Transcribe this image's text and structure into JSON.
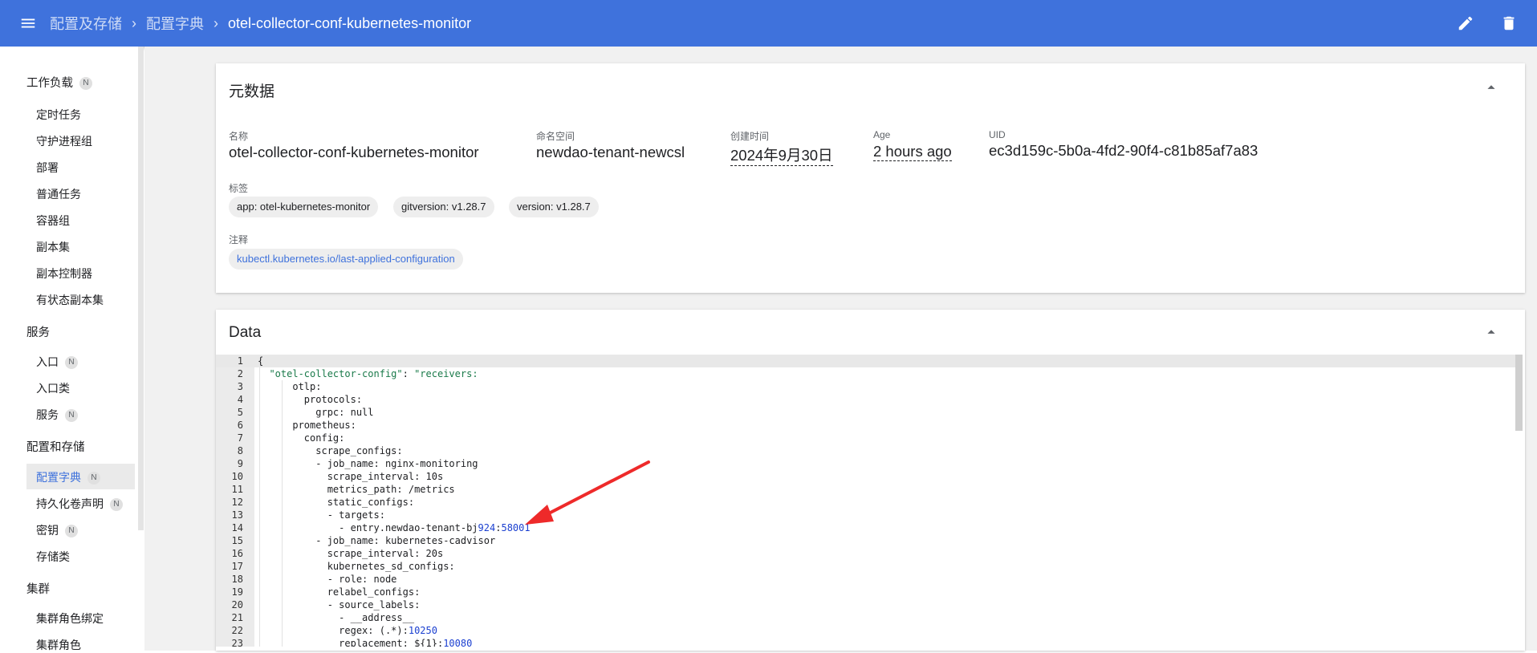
{
  "header": {
    "breadcrumbs": [
      "配置及存储",
      "配置字典"
    ],
    "current": "otel-collector-conf-kubernetes-monitor",
    "sep": "›"
  },
  "sidebar": {
    "groups": [
      {
        "label": "工作负载",
        "badge": "N",
        "items": [
          {
            "label": "定时任务"
          },
          {
            "label": "守护进程组"
          },
          {
            "label": "部署"
          },
          {
            "label": "普通任务"
          },
          {
            "label": "容器组"
          },
          {
            "label": "副本集"
          },
          {
            "label": "副本控制器"
          },
          {
            "label": "有状态副本集"
          }
        ]
      },
      {
        "label": "服务",
        "items": [
          {
            "label": "入口",
            "badge": "N"
          },
          {
            "label": "入口类"
          },
          {
            "label": "服务",
            "badge": "N"
          }
        ]
      },
      {
        "label": "配置和存储",
        "items": [
          {
            "label": "配置字典",
            "badge": "N",
            "active": true
          },
          {
            "label": "持久化卷声明",
            "badge": "N"
          },
          {
            "label": "密钥",
            "badge": "N"
          },
          {
            "label": "存储类"
          }
        ]
      },
      {
        "label": "集群",
        "items": [
          {
            "label": "集群角色绑定"
          },
          {
            "label": "集群角色"
          }
        ]
      }
    ]
  },
  "metadata": {
    "title": "元数据",
    "name_label": "名称",
    "name": "otel-collector-conf-kubernetes-monitor",
    "namespace_label": "命名空间",
    "namespace": "newdao-tenant-newcsl",
    "created_label": "创建时间",
    "created": "2024年9月30日",
    "age_label": "Age",
    "age": "2 hours ago",
    "uid_label": "UID",
    "uid": "ec3d159c-5b0a-4fd2-90f4-c81b85af7a83",
    "labels_label": "标签",
    "labels": [
      "app: otel-kubernetes-monitor",
      "gitversion: v1.28.7",
      "version: v1.28.7"
    ],
    "annotations_label": "注释",
    "annotations": [
      "kubectl.kubernetes.io/last-applied-configuration"
    ]
  },
  "data_card": {
    "title": "Data",
    "lines": [
      {
        "n": "1",
        "code": "{"
      },
      {
        "n": "2",
        "code": "  \"otel-collector-config\": \"receivers:"
      },
      {
        "n": "3",
        "code": "      otlp:"
      },
      {
        "n": "4",
        "code": "        protocols:"
      },
      {
        "n": "5",
        "code": "          grpc: null"
      },
      {
        "n": "6",
        "code": "      prometheus:"
      },
      {
        "n": "7",
        "code": "        config:"
      },
      {
        "n": "8",
        "code": "          scrape_configs:"
      },
      {
        "n": "9",
        "code": "          - job_name: nginx-monitoring"
      },
      {
        "n": "10",
        "code": "            scrape_interval: 10s"
      },
      {
        "n": "11",
        "code": "            metrics_path: /metrics"
      },
      {
        "n": "12",
        "code": "            static_configs:"
      },
      {
        "n": "13",
        "code": "            - targets:"
      },
      {
        "n": "14",
        "code": "              - entry.newdao-tenant-bj924:58001"
      },
      {
        "n": "15",
        "code": "          - job_name: kubernetes-cadvisor"
      },
      {
        "n": "16",
        "code": "            scrape_interval: 20s"
      },
      {
        "n": "17",
        "code": "            kubernetes_sd_configs:"
      },
      {
        "n": "18",
        "code": "            - role: node"
      },
      {
        "n": "19",
        "code": "            relabel_configs:"
      },
      {
        "n": "20",
        "code": "            - source_labels:"
      },
      {
        "n": "21",
        "code": "              - __address__"
      },
      {
        "n": "22",
        "code": "              regex: (.*):10250"
      },
      {
        "n": "23",
        "code": "              replacement: ${1}:10080"
      }
    ]
  },
  "annotation_arrow": {
    "color": "#ee2a2a"
  }
}
